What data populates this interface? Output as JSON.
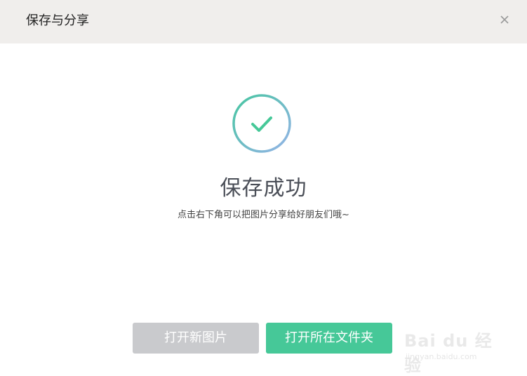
{
  "dialog": {
    "title": "保存与分享",
    "close_icon": "close-icon"
  },
  "status": {
    "icon": "check-circle-icon",
    "title": "保存成功",
    "subtitle": "点击右下角可以把图片分享给好朋友们哦~"
  },
  "buttons": {
    "open_new_image": "打开新图片",
    "open_folder": "打开所在文件夹"
  },
  "watermark": {
    "brand": "Bai du 经验",
    "url": "jingyan.baidu.com"
  },
  "colors": {
    "header_bg": "#f0eeec",
    "accent_green": "#46c898",
    "check_ring_top": "#4cc3a0",
    "check_ring_bottom": "#90b4e6",
    "disabled_button": "#c9cacd"
  }
}
